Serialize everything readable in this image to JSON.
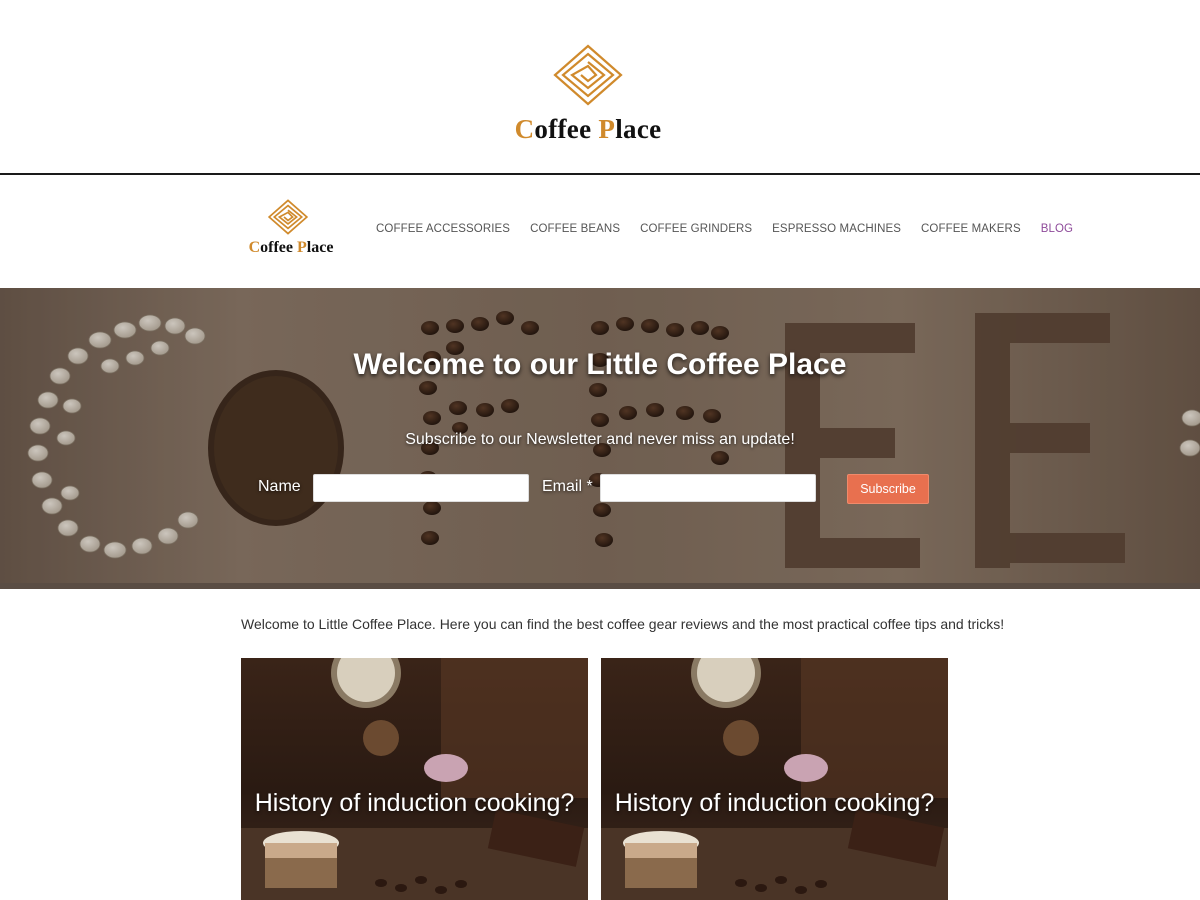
{
  "site": {
    "name_first_initial": "C",
    "name_first_rest": "offee ",
    "name_second_initial": "P",
    "name_second_rest": "lace"
  },
  "colors": {
    "brand_accent": "#d08a2c",
    "active_nav": "#8e4a9a",
    "subscribe_button": "#e8704f"
  },
  "icons": {
    "logo": "diamond-spiral-logo-icon"
  },
  "nav": {
    "items": [
      {
        "label": "COFFEE ACCESSORIES",
        "active": false
      },
      {
        "label": "COFFEE BEANS",
        "active": false
      },
      {
        "label": "COFFEE GRINDERS",
        "active": false
      },
      {
        "label": "ESPRESSO MACHINES",
        "active": false
      },
      {
        "label": "COFFEE MAKERS",
        "active": false
      },
      {
        "label": "BLOG",
        "active": true
      }
    ]
  },
  "hero": {
    "title": "Welcome to our Little Coffee Place",
    "subtitle": "Subscribe to our Newsletter and never miss an update!",
    "name_label": "Name",
    "email_label": "Email *",
    "name_value": "",
    "email_value": "",
    "subscribe_label": "Subscribe"
  },
  "intro": {
    "text": "Welcome to Little Coffee Place. Here you can find the best coffee gear reviews and the most practical coffee tips and tricks!"
  },
  "posts": [
    {
      "title": "History of induction cooking?"
    },
    {
      "title": "History of induction cooking?"
    }
  ]
}
